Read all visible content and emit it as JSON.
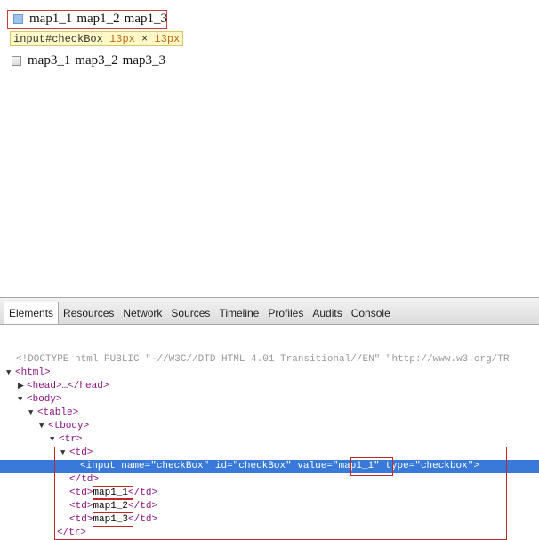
{
  "page": {
    "row1": {
      "cells": [
        "map1_1",
        "map1_2",
        "map1_3"
      ]
    },
    "row2": {
      "cells": [
        "map3_1",
        "map3_2",
        "map3_3"
      ]
    }
  },
  "tooltip": {
    "selector": "input#checkBox",
    "size_w": "13",
    "size_unit": "px",
    "times": "×",
    "size_h": "13"
  },
  "devtools": {
    "tabs": [
      "Elements",
      "Resources",
      "Network",
      "Sources",
      "Timeline",
      "Profiles",
      "Audits",
      "Console"
    ],
    "active_tab": "Elements",
    "doctype": "<!DOCTYPE html PUBLIC \"-//W3C//DTD HTML 4.01 Transitional//EN\" \"http://www.w3.org/TR",
    "nodes": {
      "html_open": "<html>",
      "head": "<head>…</head>",
      "body_open": "<body>",
      "table_open": "<table>",
      "tbody_open": "<tbody>",
      "tr_open": "<tr>",
      "td_open": "<td>",
      "input_tag_open": "<input",
      "input_name_attr": "name",
      "input_name_val": "\"checkBox\"",
      "input_id_attr": "id",
      "input_id_val": "\"checkBox\"",
      "input_value_attr": "value",
      "input_value_val": "map1_1",
      "input_type_attr": "type",
      "input_type_val": "\"checkbox\"",
      "input_tag_close": ">",
      "td_close": "</td>",
      "td_cells": [
        "map1_1",
        "map1_2",
        "map1_3"
      ],
      "tr_close": "</tr>"
    }
  }
}
